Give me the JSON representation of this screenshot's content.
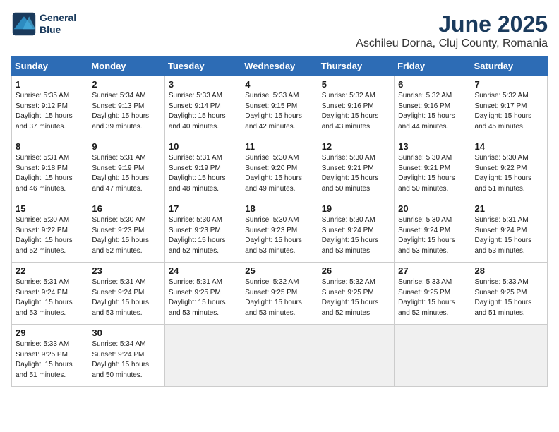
{
  "header": {
    "logo_line1": "General",
    "logo_line2": "Blue",
    "title": "June 2025",
    "subtitle": "Aschileu Dorna, Cluj County, Romania"
  },
  "calendar": {
    "days_of_week": [
      "Sunday",
      "Monday",
      "Tuesday",
      "Wednesday",
      "Thursday",
      "Friday",
      "Saturday"
    ],
    "weeks": [
      [
        {
          "num": "",
          "info": ""
        },
        {
          "num": "2",
          "info": "Sunrise: 5:34 AM\nSunset: 9:13 PM\nDaylight: 15 hours\nand 39 minutes."
        },
        {
          "num": "3",
          "info": "Sunrise: 5:33 AM\nSunset: 9:14 PM\nDaylight: 15 hours\nand 40 minutes."
        },
        {
          "num": "4",
          "info": "Sunrise: 5:33 AM\nSunset: 9:15 PM\nDaylight: 15 hours\nand 42 minutes."
        },
        {
          "num": "5",
          "info": "Sunrise: 5:32 AM\nSunset: 9:16 PM\nDaylight: 15 hours\nand 43 minutes."
        },
        {
          "num": "6",
          "info": "Sunrise: 5:32 AM\nSunset: 9:16 PM\nDaylight: 15 hours\nand 44 minutes."
        },
        {
          "num": "7",
          "info": "Sunrise: 5:32 AM\nSunset: 9:17 PM\nDaylight: 15 hours\nand 45 minutes."
        }
      ],
      [
        {
          "num": "8",
          "info": "Sunrise: 5:31 AM\nSunset: 9:18 PM\nDaylight: 15 hours\nand 46 minutes."
        },
        {
          "num": "9",
          "info": "Sunrise: 5:31 AM\nSunset: 9:19 PM\nDaylight: 15 hours\nand 47 minutes."
        },
        {
          "num": "10",
          "info": "Sunrise: 5:31 AM\nSunset: 9:19 PM\nDaylight: 15 hours\nand 48 minutes."
        },
        {
          "num": "11",
          "info": "Sunrise: 5:30 AM\nSunset: 9:20 PM\nDaylight: 15 hours\nand 49 minutes."
        },
        {
          "num": "12",
          "info": "Sunrise: 5:30 AM\nSunset: 9:21 PM\nDaylight: 15 hours\nand 50 minutes."
        },
        {
          "num": "13",
          "info": "Sunrise: 5:30 AM\nSunset: 9:21 PM\nDaylight: 15 hours\nand 50 minutes."
        },
        {
          "num": "14",
          "info": "Sunrise: 5:30 AM\nSunset: 9:22 PM\nDaylight: 15 hours\nand 51 minutes."
        }
      ],
      [
        {
          "num": "15",
          "info": "Sunrise: 5:30 AM\nSunset: 9:22 PM\nDaylight: 15 hours\nand 52 minutes."
        },
        {
          "num": "16",
          "info": "Sunrise: 5:30 AM\nSunset: 9:23 PM\nDaylight: 15 hours\nand 52 minutes."
        },
        {
          "num": "17",
          "info": "Sunrise: 5:30 AM\nSunset: 9:23 PM\nDaylight: 15 hours\nand 52 minutes."
        },
        {
          "num": "18",
          "info": "Sunrise: 5:30 AM\nSunset: 9:23 PM\nDaylight: 15 hours\nand 53 minutes."
        },
        {
          "num": "19",
          "info": "Sunrise: 5:30 AM\nSunset: 9:24 PM\nDaylight: 15 hours\nand 53 minutes."
        },
        {
          "num": "20",
          "info": "Sunrise: 5:30 AM\nSunset: 9:24 PM\nDaylight: 15 hours\nand 53 minutes."
        },
        {
          "num": "21",
          "info": "Sunrise: 5:31 AM\nSunset: 9:24 PM\nDaylight: 15 hours\nand 53 minutes."
        }
      ],
      [
        {
          "num": "22",
          "info": "Sunrise: 5:31 AM\nSunset: 9:24 PM\nDaylight: 15 hours\nand 53 minutes."
        },
        {
          "num": "23",
          "info": "Sunrise: 5:31 AM\nSunset: 9:24 PM\nDaylight: 15 hours\nand 53 minutes."
        },
        {
          "num": "24",
          "info": "Sunrise: 5:31 AM\nSunset: 9:25 PM\nDaylight: 15 hours\nand 53 minutes."
        },
        {
          "num": "25",
          "info": "Sunrise: 5:32 AM\nSunset: 9:25 PM\nDaylight: 15 hours\nand 53 minutes."
        },
        {
          "num": "26",
          "info": "Sunrise: 5:32 AM\nSunset: 9:25 PM\nDaylight: 15 hours\nand 52 minutes."
        },
        {
          "num": "27",
          "info": "Sunrise: 5:33 AM\nSunset: 9:25 PM\nDaylight: 15 hours\nand 52 minutes."
        },
        {
          "num": "28",
          "info": "Sunrise: 5:33 AM\nSunset: 9:25 PM\nDaylight: 15 hours\nand 51 minutes."
        }
      ],
      [
        {
          "num": "29",
          "info": "Sunrise: 5:33 AM\nSunset: 9:25 PM\nDaylight: 15 hours\nand 51 minutes."
        },
        {
          "num": "30",
          "info": "Sunrise: 5:34 AM\nSunset: 9:24 PM\nDaylight: 15 hours\nand 50 minutes."
        },
        {
          "num": "",
          "info": ""
        },
        {
          "num": "",
          "info": ""
        },
        {
          "num": "",
          "info": ""
        },
        {
          "num": "",
          "info": ""
        },
        {
          "num": "",
          "info": ""
        }
      ]
    ],
    "week1_day1": {
      "num": "1",
      "info": "Sunrise: 5:35 AM\nSunset: 9:12 PM\nDaylight: 15 hours\nand 37 minutes."
    }
  }
}
